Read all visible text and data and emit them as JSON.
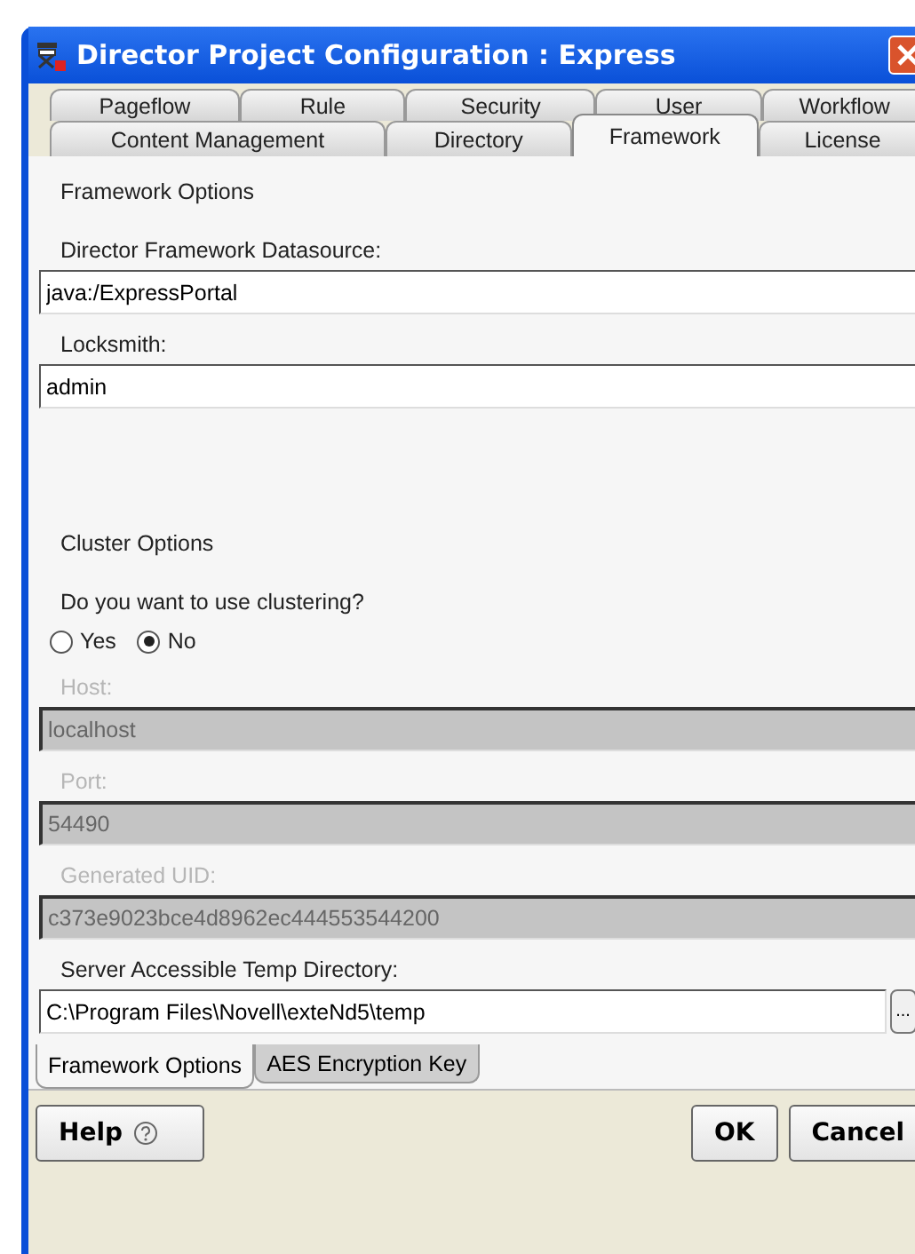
{
  "window": {
    "title": "Director Project Configuration : Express"
  },
  "tab_rows": [
    {
      "tabs": [
        {
          "label": "Pageflow",
          "selected": false
        },
        {
          "label": "Rule",
          "selected": false
        },
        {
          "label": "Security",
          "selected": false
        },
        {
          "label": "User",
          "selected": false
        },
        {
          "label": "Workflow",
          "selected": false
        }
      ]
    },
    {
      "tabs": [
        {
          "label": "Content Management",
          "selected": false
        },
        {
          "label": "Directory",
          "selected": false
        },
        {
          "label": "Framework",
          "selected": true
        },
        {
          "label": "License",
          "selected": false
        }
      ]
    }
  ],
  "items": [
    {
      "kind": "heading",
      "text": "Framework Options"
    },
    {
      "kind": "field",
      "label": "Director Framework Datasource:",
      "value": "java:/ExpressPortal",
      "disabled": false
    },
    {
      "kind": "field",
      "label": "Locksmith:",
      "value": "admin",
      "disabled": false
    },
    {
      "kind": "heading",
      "text": "Cluster Options"
    },
    {
      "kind": "text",
      "text": "Do you want to use clustering?"
    },
    {
      "kind": "radio",
      "options": [
        {
          "label": "Yes",
          "selected": false
        },
        {
          "label": "No",
          "selected": true
        }
      ]
    },
    {
      "kind": "field",
      "label": "Host:",
      "value": "localhost",
      "disabled": true
    },
    {
      "kind": "field",
      "label": "Port:",
      "value": "54490",
      "disabled": true
    },
    {
      "kind": "field",
      "label": "Generated UID:",
      "value": "c373e9023bce4d8962ec444553544200",
      "disabled": true
    },
    {
      "kind": "browse",
      "label": "Server Accessible Temp Directory:",
      "value": "C:\\Program Files\\Novell\\exteNd5\\temp",
      "button": "..."
    }
  ],
  "bottom_tabs": [
    {
      "label": "Framework Options",
      "selected": true
    },
    {
      "label": "AES Encryption Key",
      "selected": false
    }
  ],
  "buttons": {
    "help": "Help",
    "ok": "OK",
    "cancel": "Cancel"
  }
}
